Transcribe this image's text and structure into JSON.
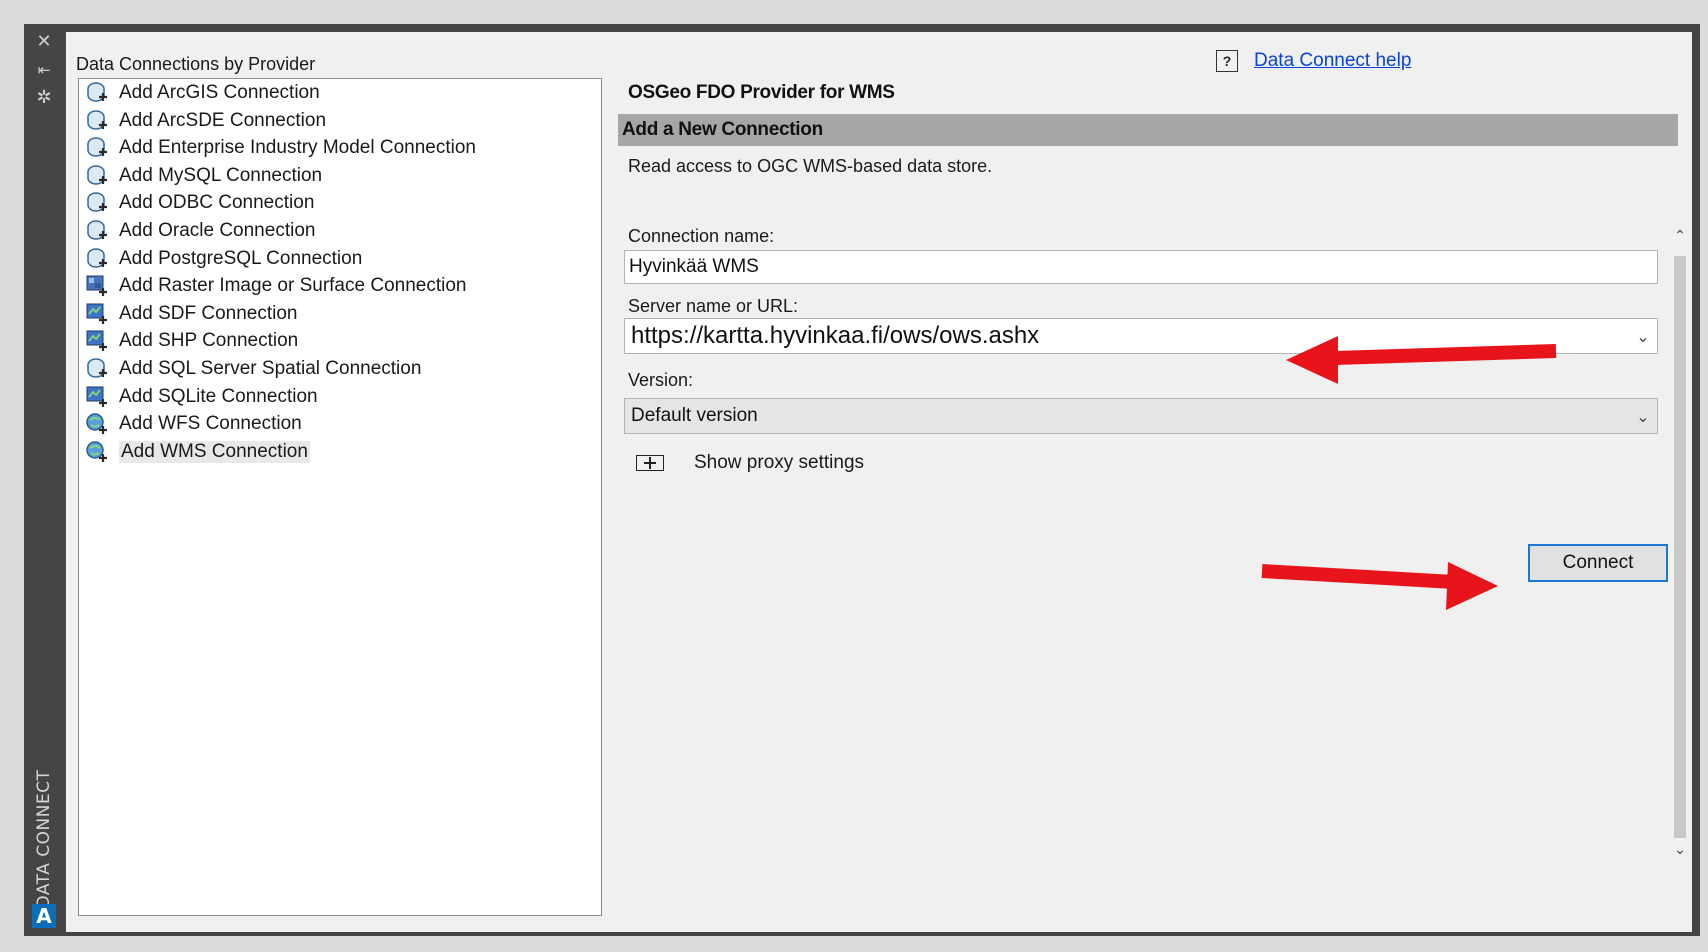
{
  "left_panel": {
    "title": "Data Connections by Provider",
    "items": [
      {
        "label": "Add ArcGIS Connection",
        "icon": "db-connection-icon"
      },
      {
        "label": "Add ArcSDE Connection",
        "icon": "db-connection-icon"
      },
      {
        "label": "Add Enterprise Industry Model Connection",
        "icon": "db-connection-icon"
      },
      {
        "label": "Add MySQL Connection",
        "icon": "db-connection-icon"
      },
      {
        "label": "Add ODBC Connection",
        "icon": "db-connection-icon"
      },
      {
        "label": "Add Oracle Connection",
        "icon": "db-connection-icon"
      },
      {
        "label": "Add PostgreSQL Connection",
        "icon": "db-connection-icon"
      },
      {
        "label": "Add Raster Image or Surface Connection",
        "icon": "raster-connection-icon"
      },
      {
        "label": "Add SDF Connection",
        "icon": "file-connection-icon"
      },
      {
        "label": "Add SHP Connection",
        "icon": "file-connection-icon"
      },
      {
        "label": "Add SQL Server Spatial Connection",
        "icon": "db-connection-icon"
      },
      {
        "label": "Add SQLite Connection",
        "icon": "file-connection-icon"
      },
      {
        "label": "Add WFS Connection",
        "icon": "web-connection-icon"
      },
      {
        "label": "Add WMS Connection",
        "icon": "web-connection-icon"
      }
    ],
    "selected_index": 13
  },
  "sidebar": {
    "title": "DATA CONNECT",
    "close_icon": "close-icon",
    "pin_icon": "pin-icon",
    "settings_icon": "settings-icon",
    "logo_letter": "A"
  },
  "help": {
    "box_text": "?",
    "link_text": "Data Connect help"
  },
  "right_panel": {
    "provider_title": "OSGeo FDO Provider for WMS",
    "section_title": "Add a New Connection",
    "description": "Read access to OGC WMS-based data store.",
    "connection_name_label": "Connection name:",
    "connection_name_value": "Hyvinkää WMS",
    "server_label": "Server name or URL:",
    "server_value": "https://kartta.hyvinkaa.fi/ows/ows.ashx",
    "version_label": "Version:",
    "version_value": "Default version",
    "proxy_label": "Show proxy settings",
    "connect_label": "Connect"
  },
  "colors": {
    "accent": "#1a78d4",
    "annotation_arrow": "#e8141c",
    "section_bar": "#a6a6a6"
  }
}
